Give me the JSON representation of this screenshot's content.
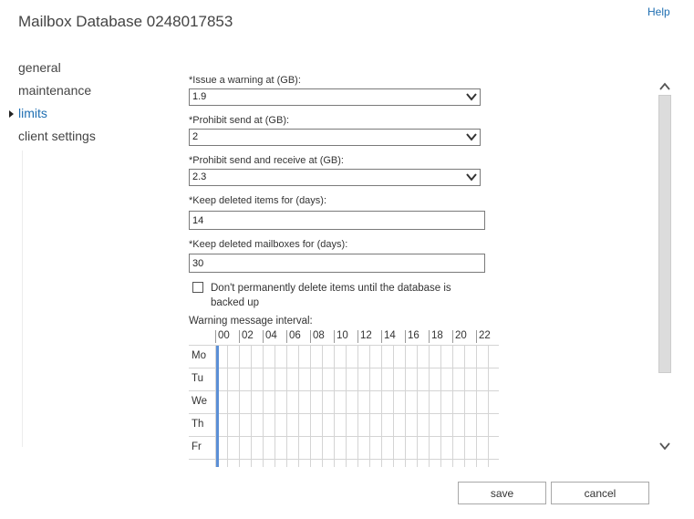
{
  "header": {
    "title": "Mailbox Database 0248017853",
    "help": "Help"
  },
  "nav": {
    "items": [
      {
        "label": "general"
      },
      {
        "label": "maintenance"
      },
      {
        "label": "limits"
      },
      {
        "label": "client settings"
      }
    ],
    "active": "limits"
  },
  "form": {
    "issue_warning": {
      "label": "*Issue a warning at (GB):",
      "value": "1.9"
    },
    "prohibit_send": {
      "label": "*Prohibit send at (GB):",
      "value": "2"
    },
    "prohibit_send_receive": {
      "label": "*Prohibit send and receive at (GB):",
      "value": "2.3"
    },
    "keep_deleted_items": {
      "label": "*Keep deleted items for (days):",
      "value": "14"
    },
    "keep_deleted_mailboxes": {
      "label": "*Keep deleted mailboxes for (days):",
      "value": "30"
    },
    "dont_delete_until_backup": {
      "label": "Don't permanently delete items until the database is backed up",
      "checked": false
    }
  },
  "schedule": {
    "label": "Warning message interval:",
    "hours": [
      "00",
      "02",
      "04",
      "06",
      "08",
      "10",
      "12",
      "14",
      "16",
      "18",
      "20",
      "22"
    ],
    "days": [
      "Mo",
      "Tu",
      "We",
      "Th",
      "Fr"
    ],
    "selected_hour": "00",
    "selected_color": "#5b8fd6"
  },
  "buttons": {
    "save": "save",
    "cancel": "cancel"
  },
  "colors": {
    "accent": "#1f6fb2",
    "grid_line": "#d4d4d4"
  }
}
